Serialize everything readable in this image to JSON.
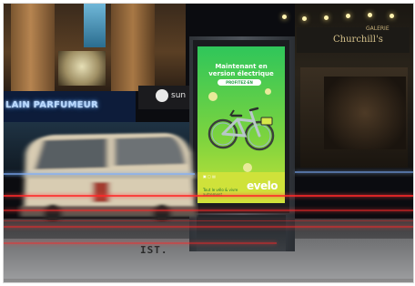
{
  "scene": {
    "shop_sign": "LAIN PARFUMEUR",
    "sun_sign": "sun",
    "galerie_label": "GALERIE",
    "galerie_name": "Churchill's",
    "pavement_marking": "IST."
  },
  "advert": {
    "headline": "Maintenant en version électrique",
    "button_label": "PROFITEZ-EN",
    "footer_text": "Tout le vélo & vivre autrement",
    "brand_logo": "evelo"
  },
  "colors": {
    "screen_green": "#2fc65a",
    "screen_lime": "#c8e238",
    "streak_red": "#ff2a2a",
    "shop_sign_blue": "#4e9cff"
  }
}
